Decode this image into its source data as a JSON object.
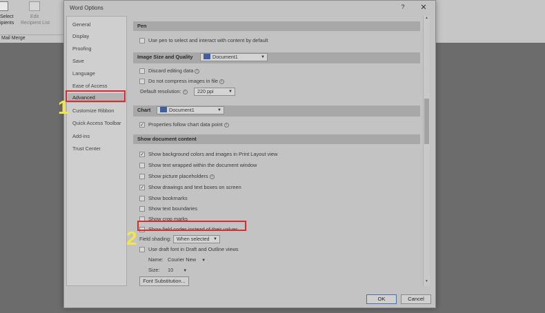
{
  "background": {
    "ribbon_buttons": [
      "Select",
      "ipients",
      "Edit",
      "Recipient List"
    ],
    "group_label": "Mail Merge"
  },
  "dialog": {
    "title": "Word Options",
    "help": "?",
    "close": "✕"
  },
  "nav": {
    "items": [
      "General",
      "Display",
      "Proofing",
      "Save",
      "Language",
      "Ease of Access",
      "Advanced",
      "Customize Ribbon",
      "Quick Access Toolbar",
      "Add-ins",
      "Trust Center"
    ],
    "selected": "Advanced"
  },
  "markers": [
    "1",
    "2"
  ],
  "content": {
    "pen": {
      "header": "Pen",
      "use_pen": "Use pen to select and interact with content by default"
    },
    "image": {
      "header": "Image Size and Quality",
      "doc": "Document1",
      "discard": "Discard editing data",
      "no_compress": "Do not compress images in file",
      "res_label": "Default resolution:",
      "res_value": "220 ppi"
    },
    "chart": {
      "header": "Chart",
      "doc": "Document1",
      "properties": "Properties follow chart data point"
    },
    "show": {
      "header": "Show document content",
      "items": [
        {
          "label": "Show background colors and images in Print Layout view",
          "checked": true
        },
        {
          "label": "Show text wrapped within the document window",
          "checked": false
        },
        {
          "label": "Show picture placeholders",
          "checked": false
        },
        {
          "label": "Show drawings and text boxes on screen",
          "checked": true
        },
        {
          "label": "Show bookmarks",
          "checked": false
        },
        {
          "label": "Show text boundaries",
          "checked": false
        },
        {
          "label": "Show crop marks",
          "checked": false
        },
        {
          "label": "Show field codes instead of their values",
          "checked": false
        }
      ],
      "field_shading_label": "Field shading:",
      "field_shading_value": "When selected",
      "draft_font": "Use draft font in Draft and Outline views",
      "name_label": "Name:",
      "name_value": "Courier New",
      "size_label": "Size:",
      "size_value": "10",
      "font_sub": "Font Substitution..."
    }
  },
  "footer": {
    "ok": "OK",
    "cancel": "Cancel"
  },
  "colors": {
    "highlight": "#e0282e",
    "marker": "#f2e64b"
  }
}
